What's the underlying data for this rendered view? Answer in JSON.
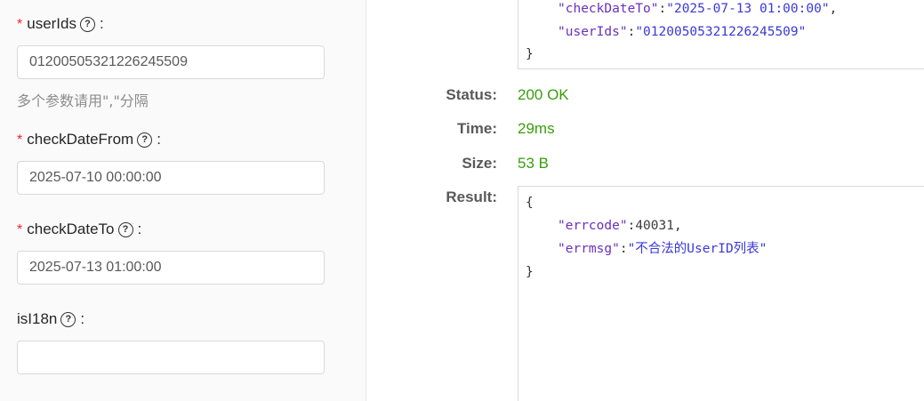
{
  "form": {
    "fields": [
      {
        "label": "userIds",
        "required": true,
        "value": "01200505321226245509",
        "placeholder": ""
      },
      {
        "label": "checkDateFrom",
        "required": true,
        "value": "2025-07-10 00:00:00",
        "placeholder": ""
      },
      {
        "label": "checkDateTo",
        "required": true,
        "value": "2025-07-13 01:00:00",
        "placeholder": ""
      },
      {
        "label": "isI18n",
        "required": false,
        "value": "",
        "placeholder": ""
      }
    ],
    "userIds_hint": "多个参数请用\",\"分隔",
    "required_mark": "*",
    "help_glyph": "?",
    "colon": ":"
  },
  "request_body": {
    "line1_key": "\"checkDateTo\"",
    "line1_sep": ":",
    "line1_value": "\"2025-07-13 01:00:00\"",
    "line1_comma": ",",
    "line2_key": "\"userIds\"",
    "line2_sep": ":",
    "line2_value": "\"01200505321226245509\"",
    "close_brace": "}"
  },
  "response": {
    "status_label": "Status:",
    "status_value": "200 OK",
    "time_label": "Time:",
    "time_value": "29ms",
    "size_label": "Size:",
    "size_value": "53 B",
    "result_label": "Result:",
    "result": {
      "open_brace": "{",
      "errcode_key": "\"errcode\"",
      "errcode_sep": ":",
      "errcode_value": "40031",
      "errcode_comma": ",",
      "errmsg_key": "\"errmsg\"",
      "errmsg_sep": ":",
      "errmsg_value": "\"不合法的UserID列表\"",
      "close_brace": "}"
    }
  },
  "colors": {
    "required": "#f5222d",
    "success": "#389e0d",
    "json_key": "#6a30b9",
    "json_string": "#3b38d6"
  },
  "icons": {
    "help": "question-circle-icon"
  }
}
